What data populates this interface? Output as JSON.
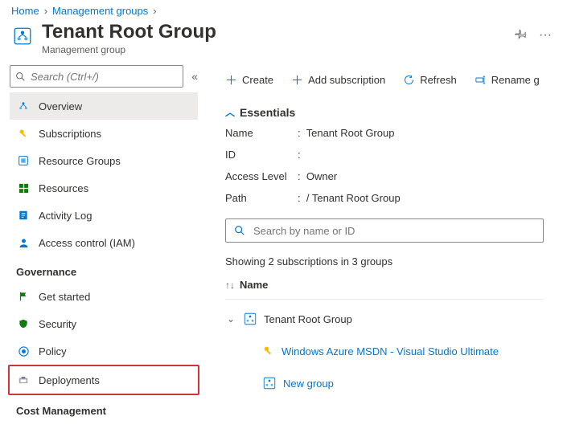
{
  "breadcrumb": {
    "items": [
      "Home",
      "Management groups"
    ],
    "sep": "›"
  },
  "header": {
    "title": "Tenant Root Group",
    "subtitle": "Management group"
  },
  "sidebar": {
    "search_placeholder": "Search (Ctrl+/)",
    "items": {
      "overview": "Overview",
      "subscriptions": "Subscriptions",
      "resource_groups": "Resource Groups",
      "resources": "Resources",
      "activity_log": "Activity Log",
      "access_control": "Access control (IAM)"
    },
    "sections": {
      "governance": "Governance",
      "cost_management": "Cost Management"
    },
    "gov_items": {
      "get_started": "Get started",
      "security": "Security",
      "policy": "Policy",
      "deployments": "Deployments"
    }
  },
  "toolbar": {
    "create": "Create",
    "add_subscription": "Add subscription",
    "refresh": "Refresh",
    "rename": "Rename g"
  },
  "essentials": {
    "heading": "Essentials",
    "name_k": "Name",
    "name_v": "Tenant Root Group",
    "id_k": "ID",
    "id_v": "",
    "access_k": "Access Level",
    "access_v": "Owner",
    "path_k": "Path",
    "path_v": "/ Tenant Root Group"
  },
  "filter": {
    "placeholder": "Search by name or ID"
  },
  "listing": {
    "count_line": "Showing 2 subscriptions in 3 groups",
    "col_name": "Name",
    "rows": {
      "root": "Tenant Root Group",
      "sub1": "Windows Azure MSDN - Visual Studio Ultimate",
      "group1": "New group"
    }
  }
}
